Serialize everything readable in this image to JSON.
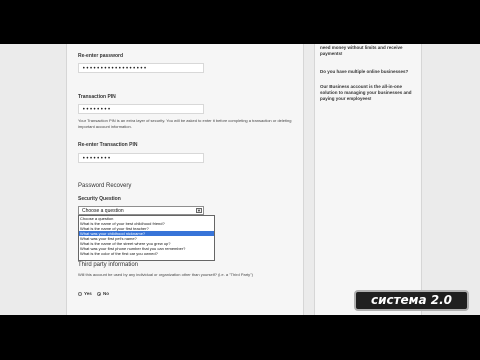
{
  "form": {
    "reenter_password_label": "Re-enter password",
    "reenter_password_value": "••••••••••••••••••",
    "transaction_pin_label": "Transaction PIN",
    "transaction_pin_value": "••••••••",
    "transaction_pin_note": "Your Transaction PIN is an extra layer of security. You will be asked to enter it before completing a transaction or deleting important account information.",
    "reenter_pin_label": "Re-enter Transaction PIN",
    "reenter_pin_value": "••••••••"
  },
  "recovery": {
    "heading": "Password Recovery",
    "question_label": "Security Question",
    "selected": "Choose a question",
    "arrow": "▼",
    "options": [
      "Choose a question",
      "What is the name of your best childhood friend?",
      "What is the name of your first teacher?",
      "What was your childhood nickname?",
      "What was your first pet's name?",
      "What is the name of the street where you grew up?",
      "What was your first phone number that you can remember?",
      "What is the color of the first car you owned?"
    ],
    "highlighted_index": 3
  },
  "third_party": {
    "heading": "Third party information",
    "question": "Will this account be used by any individual or organization other than yourself? (i.e. a \"Third Party\")",
    "yes_label": "Yes",
    "no_label": "No",
    "selected": "No"
  },
  "sidebar": {
    "text1": "need money without limits and receive payments!",
    "text2": "Do you have multiple online businesses?",
    "text3": "Our Business account is the all-in-one solution to managing your businesses and paying your employees!"
  },
  "watermark": {
    "text": "система 2.0"
  }
}
